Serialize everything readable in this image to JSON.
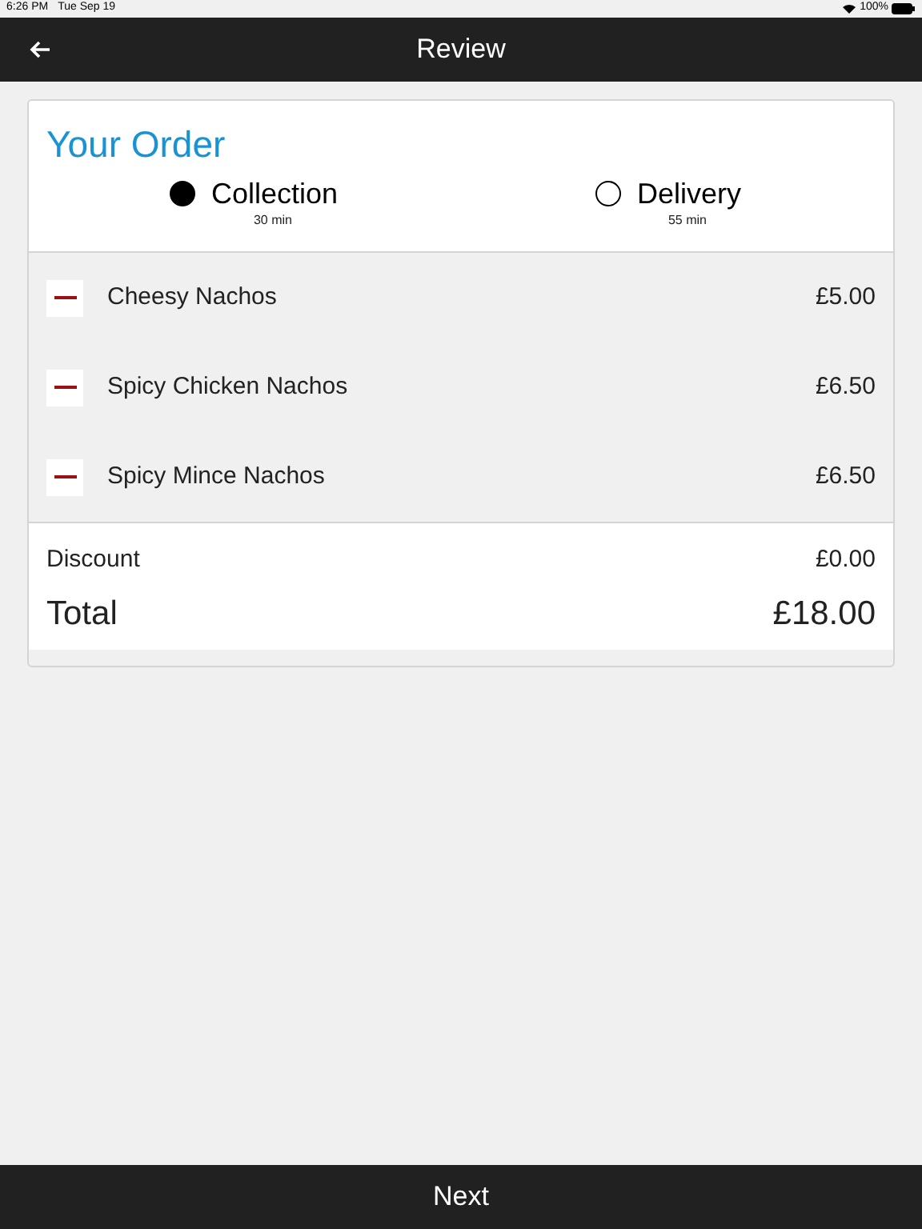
{
  "status_bar": {
    "time": "6:26 PM",
    "date": "Tue Sep 19",
    "battery": "100%"
  },
  "header": {
    "title": "Review"
  },
  "order": {
    "title": "Your Order",
    "options": [
      {
        "label": "Collection",
        "time": "30 min",
        "selected": true
      },
      {
        "label": "Delivery",
        "time": "55 min",
        "selected": false
      }
    ],
    "items": [
      {
        "name": "Cheesy Nachos",
        "price": "£5.00"
      },
      {
        "name": "Spicy Chicken Nachos",
        "price": "£6.50"
      },
      {
        "name": "Spicy Mince Nachos",
        "price": "£6.50"
      }
    ],
    "discount": {
      "label": "Discount",
      "value": "£0.00"
    },
    "total": {
      "label": "Total",
      "value": "£18.00"
    }
  },
  "footer": {
    "button": "Next"
  }
}
